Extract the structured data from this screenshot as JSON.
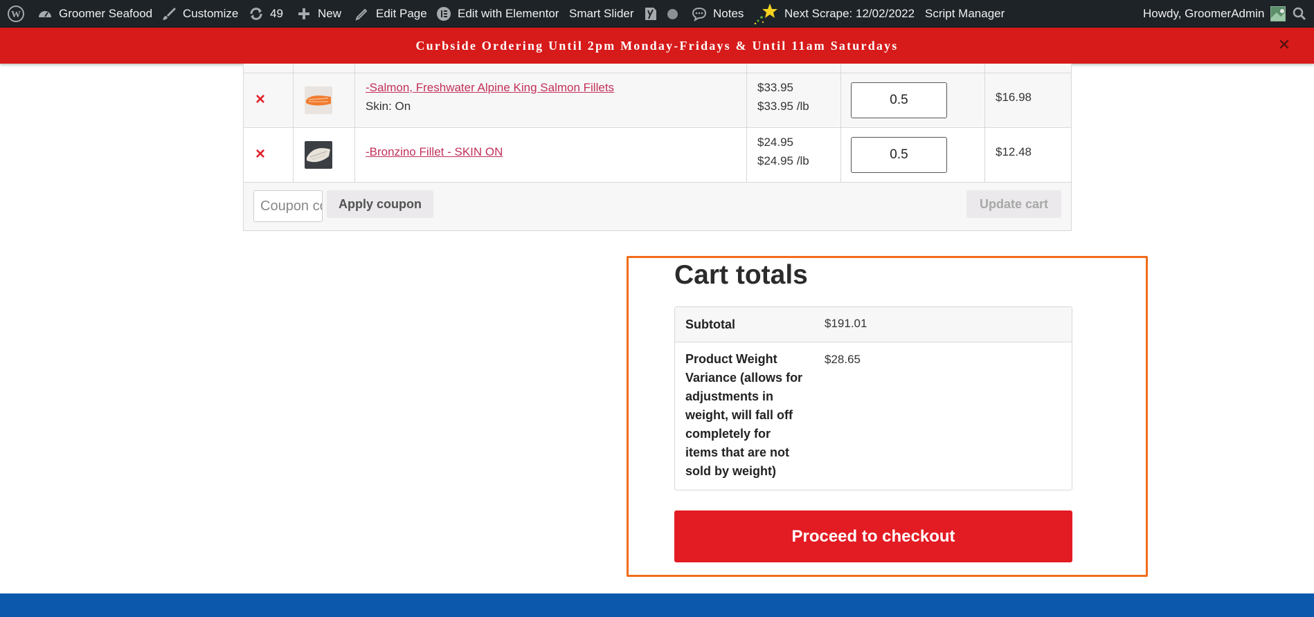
{
  "admin_bar": {
    "site_name": "Groomer Seafood",
    "customize": "Customize",
    "updates_count": "49",
    "new": "New",
    "edit_page": "Edit Page",
    "edit_elementor": "Edit with Elementor",
    "smart_slider": "Smart Slider",
    "notes": "Notes",
    "next_scrape": "Next Scrape: 12/02/2022",
    "script_manager": "Script Manager",
    "howdy": "Howdy, GroomerAdmin"
  },
  "notice": {
    "text": "Curbside Ordering Until 2pm Monday-Fridays & Until 11am Saturdays",
    "close": "✕"
  },
  "cart": {
    "items": [
      {
        "remove": "×",
        "name": "-Salmon, Freshwater Alpine King Salmon Fillets",
        "meta": "Skin: On",
        "price": "$33.95",
        "price_per_lb": "$33.95 /lb",
        "quantity": "0.5",
        "subtotal": "$16.98",
        "thumb_colors": [
          "#e9e4df",
          "#f07b2e"
        ]
      },
      {
        "remove": "×",
        "name": "-Bronzino Fillet - SKIN ON",
        "meta": "",
        "price": "$24.95",
        "price_per_lb": "$24.95 /lb",
        "quantity": "0.5",
        "subtotal": "$12.48",
        "thumb_colors": [
          "#3b3f44",
          "#e8e3da"
        ]
      }
    ],
    "coupon_placeholder": "Coupon code",
    "apply_coupon": "Apply coupon",
    "update_cart": "Update cart"
  },
  "totals": {
    "title": "Cart totals",
    "rows": [
      {
        "label": "Subtotal",
        "value": "$191.01"
      },
      {
        "label": "Product Weight Variance (allows for adjustments in weight, will fall off completely for items that are not sold by weight)",
        "value": "$28.65"
      }
    ],
    "checkout": "Proceed to checkout"
  },
  "colors": {
    "admin_bar": "#1d2327",
    "notice": "#d71a1a",
    "link": "#c2305a",
    "remove": "#e2202a",
    "checkout": "#e31b23",
    "highlight": "#f26c1a",
    "footer": "#0c58ad"
  }
}
